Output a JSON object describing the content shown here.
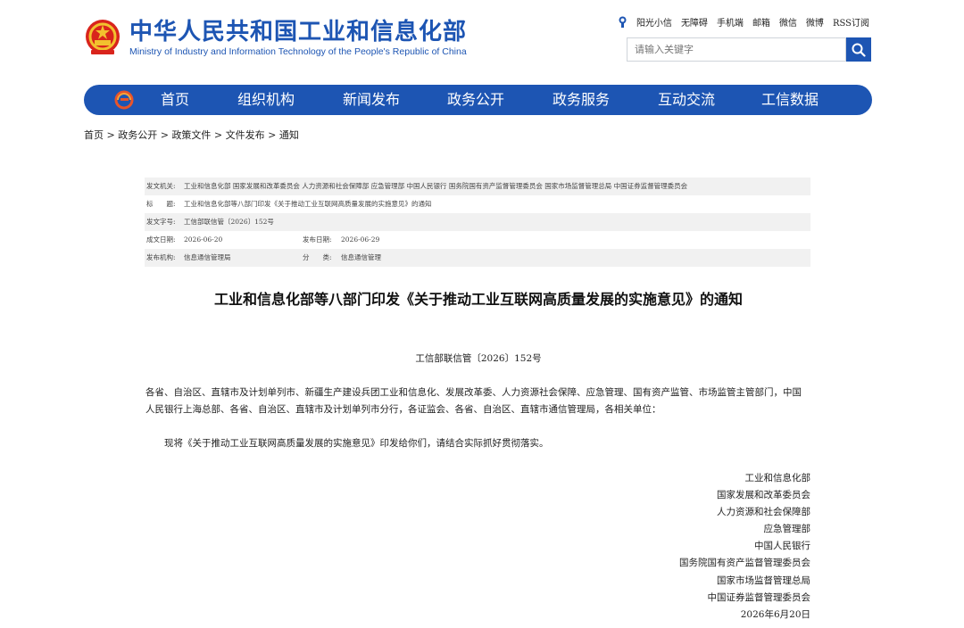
{
  "header": {
    "title": "中华人民共和国工业和信息化部",
    "subtitle": "Ministry of Industry and Information Technology of the People's Republic of China",
    "links": [
      "阳光小信",
      "无障碍",
      "手机端",
      "邮箱",
      "微信",
      "微博",
      "RSS订阅"
    ],
    "search_placeholder": "请输入关键字",
    "brand_color": "#1d55b3"
  },
  "nav": {
    "items": [
      "首页",
      "组织机构",
      "新闻发布",
      "政务公开",
      "政务服务",
      "互动交流",
      "工信数据"
    ]
  },
  "breadcrumb": [
    "首页",
    "政务公开",
    "政策文件",
    "文件发布",
    "通知"
  ],
  "meta": {
    "issuer_label": "发文机关:",
    "issuer": "工业和信息化部 国家发展和改革委员会 人力资源和社会保障部 应急管理部 中国人民银行 国务院国有资产监督管理委员会 国家市场监督管理总局 中国证券监督管理委员会",
    "subject_label": "标　　题:",
    "subject": "工业和信息化部等八部门印发《关于推动工业互联网高质量发展的实施意见》的通知",
    "docno_label": "发文字号:",
    "docno": "工信部联信管〔2026〕152号",
    "created_label": "成文日期:",
    "created": "2026-06-20",
    "published_label": "发布日期:",
    "published": "2026-06-29",
    "org_label": "发布机构:",
    "org": "信息通信管理局",
    "category_label": "分　　类:",
    "category": "信息通信管理"
  },
  "article": {
    "title": "工业和信息化部等八部门印发《关于推动工业互联网高质量发展的实施意见》的通知",
    "docno": "工信部联信管〔2026〕152号",
    "addressees": "各省、自治区、直辖市及计划单列市、新疆生产建设兵团工业和信息化、发展改革委、人力资源社会保障、应急管理、国有资产监管、市场监管主管部门，中国人民银行上海总部、各省、自治区、直辖市及计划单列市分行，各证监会、各省、自治区、直辖市通信管理局，各相关单位：",
    "body": "现将《关于推动工业互联网高质量发展的实施意见》印发给你们，请结合实际抓好贯彻落实。",
    "signatories": [
      "工业和信息化部",
      "国家发展和改革委员会",
      "人力资源和社会保障部",
      "应急管理部",
      "中国人民银行",
      "国务院国有资产监督管理委员会",
      "国家市场监督管理总局",
      "中国证券监督管理委员会"
    ],
    "date": "2026年6月20日"
  }
}
